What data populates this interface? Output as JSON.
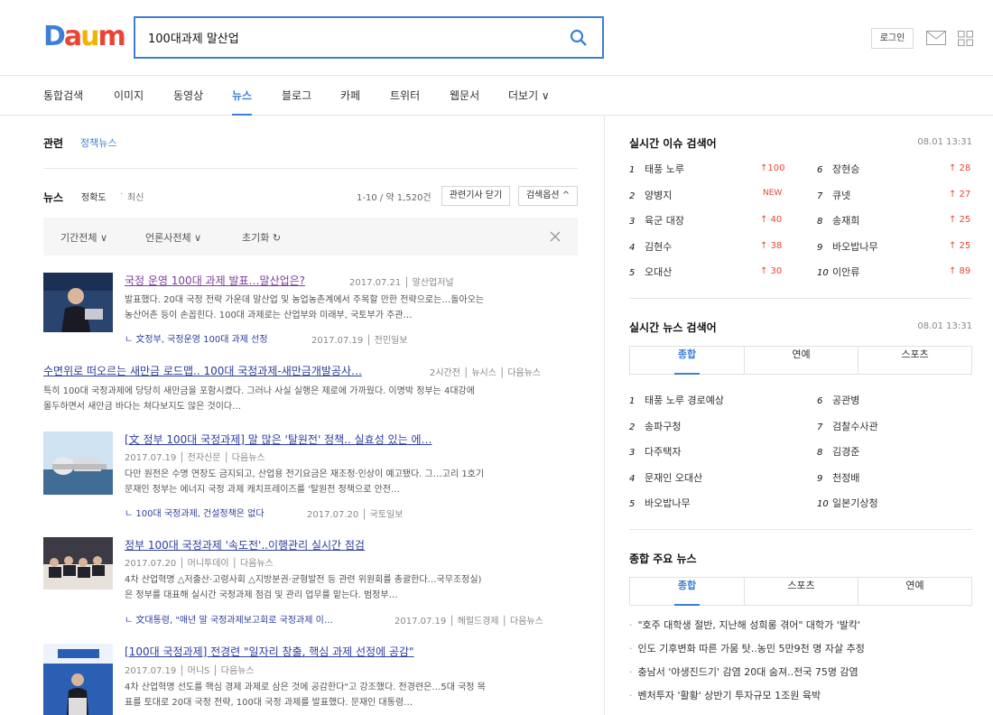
{
  "header": {
    "logo_text": "Daum",
    "search_value": "100대과제 말산업",
    "login_label": "로그인"
  },
  "tabs": [
    {
      "label": "통합검색"
    },
    {
      "label": "이미지"
    },
    {
      "label": "동영상"
    },
    {
      "label": "뉴스"
    },
    {
      "label": "블로그"
    },
    {
      "label": "카페"
    },
    {
      "label": "트위터"
    },
    {
      "label": "웹문서"
    },
    {
      "label": "더보기 ∨"
    }
  ],
  "related": {
    "label": "관련",
    "link": "정책뉴스"
  },
  "news_header": {
    "label": "뉴스",
    "sort_accuracy": "정확도",
    "sort_sep": "·",
    "sort_latest": "최신",
    "count": "1-10 / 약 1,520건",
    "close_related": "관련기사 닫기",
    "search_options": "검색옵션 ^"
  },
  "filters": {
    "period": "기간전체 ∨",
    "press": "언론사전체 ∨",
    "reset": "초기화 ↻"
  },
  "articles": [
    {
      "title": "국정 운영 100대 과제 발표…말산업은?",
      "meta": "2017.07.21 │ 말산업저널",
      "desc1": "발표했다. 20대 국정 전략 가운데 말산업 및 농업농촌계에서 주목할 만한 전략으로는…돌아오는",
      "desc2": "농산어촌 등이 손꼽힌다. 100대 과제로는 산업부와 미래부, 국토부가 주관…",
      "sub": "ㄴ 文정부, 국정운영 100대 과제 선정",
      "sub_meta": "2017.07.19 │ 전민일보"
    },
    {
      "title": "수면위로 떠오르는 새만금 로드맵.. 100대 국정과제-새만금개발공사…",
      "meta": "2시간전 │ 뉴시스 │ 다음뉴스",
      "desc1": "특히 100대 국정과제에 당당히 새만금을 포함시켰다. 그러나 사실 실행은 제로에 가까웠다. 이명박 정부는 4대강에",
      "desc2": "몰두하면서 새만금 바다는 쳐다보지도 않은 것이다…"
    },
    {
      "title": "[文 정부 100대 국정과제] 말 많은 '탈원전' 정책.. 실효성 있는 에…",
      "meta": "2017.07.19 │ 전자신문 │ 다음뉴스",
      "desc1": "다만 원전은 수명 연장도 금지되고, 산업용 전기요금은 재조정·인상이 예고됐다. 그…고리 1호기",
      "desc2": "문재인 정부는 에너지 국정 과제 캐치프레이즈를 '탈원전 정책으로 안전…",
      "sub": "ㄴ 100대 국정과제, 건설정책은 없다",
      "sub_meta": "2017.07.20 │ 국토일보"
    },
    {
      "title": "정부 100대 국정과제 '속도전'..이행관리 실시간 점검",
      "meta": "2017.07.20 │ 머니투데이 │ 다음뉴스",
      "desc1": "4차 산업혁명 △저출산·고령사회 △지방분권·균형발전 등 관련 위원회를 총괄한다…국무조정실)",
      "desc2": "은 정부를 대표해 실시간 국정과제 점검 및 관리 업무를 맡는다. 범정부…",
      "sub": "ㄴ 文대통령, \"매년 말 국정과제보고회로 국정과제 이…",
      "sub_meta": "2017.07.19 │ 헤럴드경제 │ 다음뉴스"
    },
    {
      "title": "[100대 국정과제] 전경련 \"일자리 창출, 핵심 과제 선정에 공감\"",
      "meta": "2017.07.19 │ 머니S │ 다음뉴스",
      "desc1": "4차 산업혁명 선도를 핵심 경제 과제로 삼은 것에 공감한다\"고 강조했다. 전경련은…5대 국정 목",
      "desc2": "표를 토대로 20대 국정 전략, 100대 국정 과제를 발표했다. 문재인 대통령…"
    }
  ],
  "realtime_issue": {
    "title": "실시간 이슈 검색어",
    "time": "08.01  13:31",
    "left": [
      {
        "rank": "1",
        "kw": "태풍 노루",
        "chg": "↑100"
      },
      {
        "rank": "2",
        "kw": "양병지",
        "chg": "NEW"
      },
      {
        "rank": "3",
        "kw": "육군 대장",
        "chg": "↑ 40"
      },
      {
        "rank": "4",
        "kw": "김현수",
        "chg": "↑ 38"
      },
      {
        "rank": "5",
        "kw": "오대산",
        "chg": "↑ 30"
      }
    ],
    "right": [
      {
        "rank": "6",
        "kw": "장현승",
        "chg": "↑ 28"
      },
      {
        "rank": "7",
        "kw": "큐넷",
        "chg": "↑ 27"
      },
      {
        "rank": "8",
        "kw": "송재희",
        "chg": "↑ 25"
      },
      {
        "rank": "9",
        "kw": "바오밥나무",
        "chg": "↑ 25"
      },
      {
        "rank": "10",
        "kw": "이안류",
        "chg": "↑ 89"
      }
    ]
  },
  "realtime_news": {
    "title": "실시간 뉴스 검색어",
    "time": "08.01  13:31",
    "tabs": [
      "종합",
      "연예",
      "스포츠"
    ],
    "left": [
      {
        "rank": "1",
        "kw": "태풍 노루 경로예상"
      },
      {
        "rank": "2",
        "kw": "송파구청"
      },
      {
        "rank": "3",
        "kw": "다주택자"
      },
      {
        "rank": "4",
        "kw": "문재인 오대산"
      },
      {
        "rank": "5",
        "kw": "바오밥나무"
      }
    ],
    "right": [
      {
        "rank": "6",
        "kw": "공관병"
      },
      {
        "rank": "7",
        "kw": "검찰수사관"
      },
      {
        "rank": "8",
        "kw": "김경준"
      },
      {
        "rank": "9",
        "kw": "천정배"
      },
      {
        "rank": "10",
        "kw": "일본기상청"
      }
    ]
  },
  "main_news": {
    "title": "종합 주요 뉴스",
    "tabs": [
      "종합",
      "스포츠",
      "연예"
    ],
    "items": [
      "\"호주 대학생 절반, 지난해 성희롱 겪어\" 대학가 '발칵'",
      "인도 기후변화 따른 가뭄 탓..농민 5만9천 명 자살 추정",
      "충남서 '야생진드기' 감염 20대 숨져..전국 75명 감염",
      "벤처투자 '활황' 상반기 투자규모 1조원 육박"
    ]
  }
}
